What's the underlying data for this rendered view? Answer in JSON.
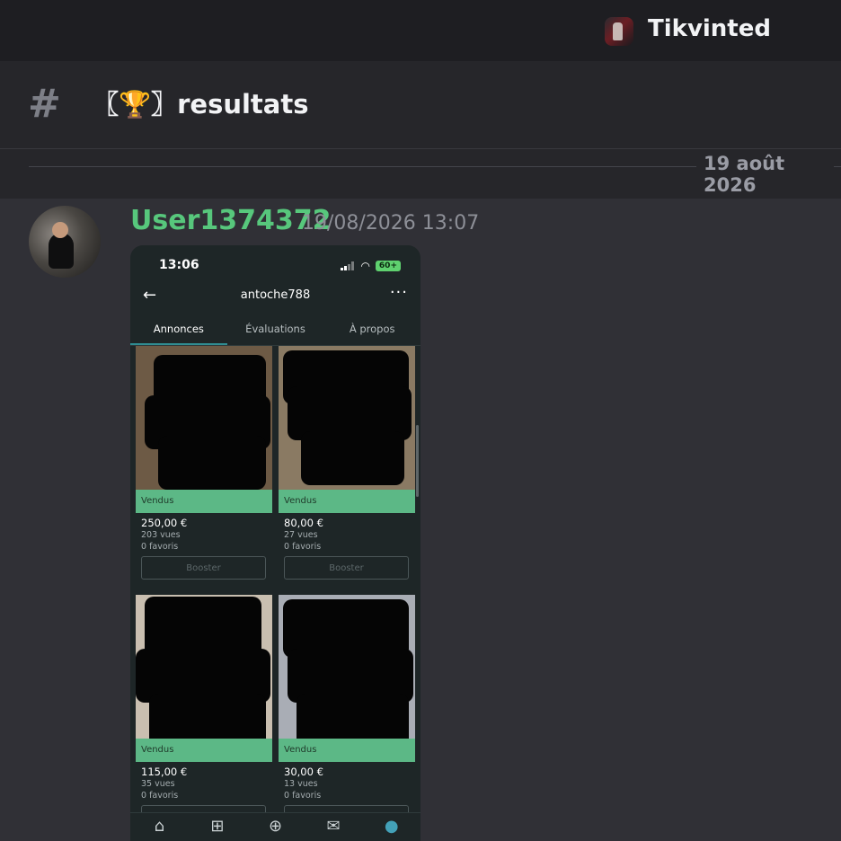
{
  "server": {
    "name": "Tikvinted"
  },
  "channel": {
    "hash": "#",
    "name": "〖🏆〗resultats"
  },
  "date_divider": "19 août 2026",
  "message": {
    "author": "User1374372",
    "timestamp": "19/08/2026 13:07"
  },
  "phone": {
    "time": "13:06",
    "battery": "60+",
    "profile_user": "antoche788",
    "tabs": [
      "Annonces",
      "Évaluations",
      "À propos"
    ],
    "active_tab": "Annonces",
    "listings": [
      {
        "status": "Vendus",
        "price": "250,00 €",
        "views": "203 vues",
        "favorites": "0 favoris",
        "button": "Booster"
      },
      {
        "status": "Vendus",
        "price": "80,00 €",
        "views": "27 vues",
        "favorites": "0 favoris",
        "button": "Booster"
      },
      {
        "status": "Vendus",
        "price": "115,00 €",
        "views": "35 vues",
        "favorites": "0 favoris",
        "button": "Booster"
      },
      {
        "status": "Vendus",
        "price": "30,00 €",
        "views": "13 vues",
        "favorites": "0 favoris",
        "button": "Booster"
      }
    ],
    "nav_icons": [
      "home-icon",
      "grid-icon",
      "plus-circle-icon",
      "mail-icon",
      "profile-icon"
    ]
  },
  "colors": {
    "author": "#57c77c",
    "sold_badge": "#5cb886",
    "active_nav": "#43a1b8"
  }
}
